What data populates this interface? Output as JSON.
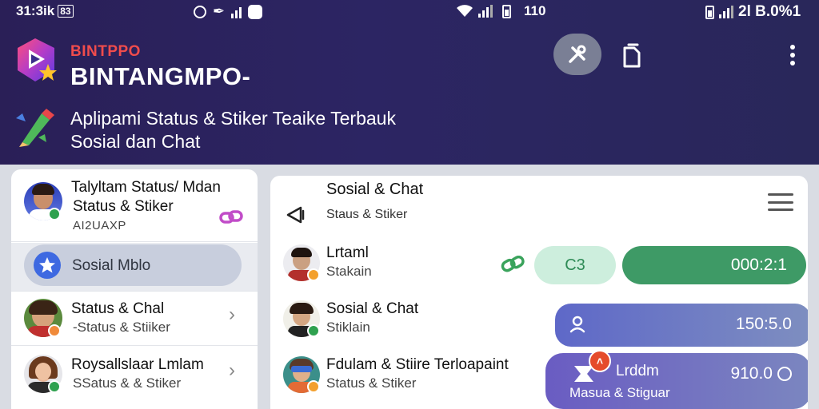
{
  "status_bar": {
    "time": "31:3ik",
    "left_badge": "83",
    "middle_text": "110",
    "right_text": "2l B.0%1"
  },
  "header": {
    "brand_small": "BINTPPO",
    "brand_big": "BINTANGMPO-",
    "tagline_line1": "Aplipami Status & Stiker Teaike Terbauk",
    "tagline_line2": "Sosial dan Chat"
  },
  "left_panel": {
    "profile": {
      "title": "Talyltam Status/ Mdan",
      "subtitle": "Status & Stiker",
      "code": "AI2UAXP"
    },
    "search": {
      "label": "Sosial Mblo"
    },
    "items": [
      {
        "title": "Status & Chal",
        "subtitle": "-Status & Stiiker"
      },
      {
        "title": "Roysallslaar Lmlam",
        "subtitle": "SSatus & & Stiker"
      }
    ]
  },
  "right_panel": {
    "title": "Sosial & Chat",
    "subtitle": "Staus & Stiker",
    "chats": [
      {
        "title": "Lrtaml",
        "subtitle": "Stakain"
      },
      {
        "title": "Sosial & Chat",
        "subtitle": "Stiklain"
      },
      {
        "title": "Fdulam & Stiire Terloapaint",
        "subtitle": "Status & Stiker"
      }
    ],
    "pill_light": "C3",
    "pill_green": "000:2:1",
    "card_blue_value": "150:5.0",
    "card_purple": {
      "label_top": "Lrddm",
      "label_bottom": "Masua & Stiguar",
      "value": "910.0",
      "notif_icon": "a-glyph"
    }
  },
  "colors": {
    "header_bg": "#2a1f57",
    "accent_red": "#f04c4c",
    "green": "#3e9a66",
    "blue_card": "#5e68c8"
  }
}
